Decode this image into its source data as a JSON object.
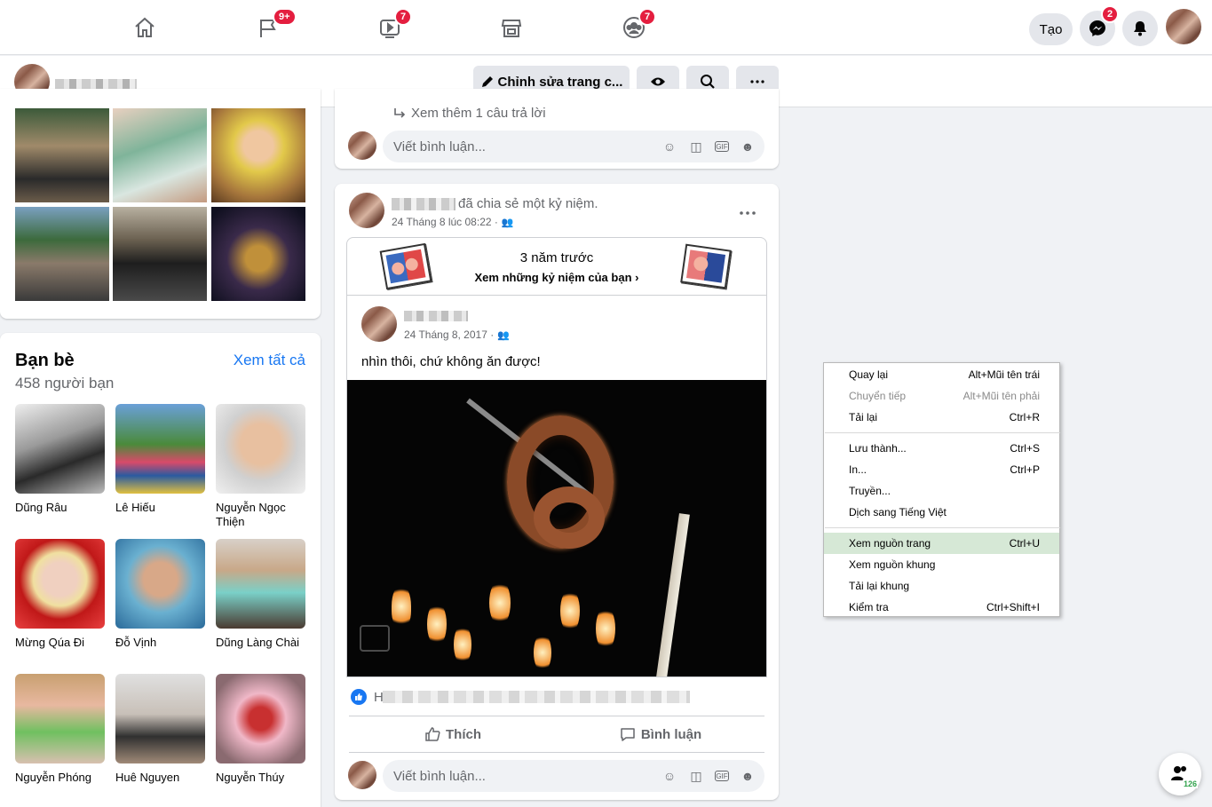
{
  "nav": {
    "badges": {
      "pages": "9+",
      "watch": "7",
      "groups": "7",
      "messenger": "2"
    },
    "create_label": "Tạo"
  },
  "profile_bar": {
    "edit_label": "Chỉnh sửa trang c..."
  },
  "friends": {
    "title": "Bạn bè",
    "see_all": "Xem tất cả",
    "count": "458 người bạn",
    "items": [
      {
        "name": "Dũng Râu"
      },
      {
        "name": "Lê Hiếu"
      },
      {
        "name": "Nguyễn Ngọc Thiện"
      },
      {
        "name": "Mừng Qúa Đi"
      },
      {
        "name": "Đỗ Vịnh"
      },
      {
        "name": "Dũng Làng Chài"
      },
      {
        "name": "Nguyễn Phóng"
      },
      {
        "name": "Huê Nguyen"
      },
      {
        "name": "Nguyễn Thúy"
      }
    ]
  },
  "feed": {
    "more_replies": "Xem thêm 1 câu trả lời",
    "comment_placeholder": "Viết bình luận...",
    "post": {
      "shared_text": "đã chia sẻ một kỷ niệm.",
      "date": "24 Tháng 8 lúc 08:22 ·",
      "memory_title": "3 năm trước",
      "memory_link": "Xem những kỷ niệm của bạn",
      "inner_date": "24 Tháng 8, 2017 ·",
      "caption": "nhìn thôi, chứ không ăn được!",
      "like_label": "Thích",
      "comment_label": "Bình luận",
      "reaction_prefix": "H"
    }
  },
  "context_menu": {
    "items": [
      {
        "label": "Quay lại",
        "shortcut": "Alt+Mũi tên trái",
        "disabled": false
      },
      {
        "label": "Chuyển tiếp",
        "shortcut": "Alt+Mũi tên phải",
        "disabled": true
      },
      {
        "label": "Tải lại",
        "shortcut": "Ctrl+R",
        "disabled": false
      },
      {
        "label": "Lưu thành...",
        "shortcut": "Ctrl+S",
        "disabled": false
      },
      {
        "label": "In...",
        "shortcut": "Ctrl+P",
        "disabled": false
      },
      {
        "label": "Truyền...",
        "shortcut": "",
        "disabled": false
      },
      {
        "label": "Dịch sang Tiếng Việt",
        "shortcut": "",
        "disabled": false
      },
      {
        "label": "Xem nguồn trang",
        "shortcut": "Ctrl+U",
        "disabled": false,
        "highlighted": true
      },
      {
        "label": "Xem nguồn khung",
        "shortcut": "",
        "disabled": false
      },
      {
        "label": "Tải lại khung",
        "shortcut": "",
        "disabled": false
      },
      {
        "label": "Kiểm tra",
        "shortcut": "Ctrl+Shift+I",
        "disabled": false
      }
    ]
  },
  "contacts_fab": {
    "count": "126"
  },
  "colors": {
    "accent": "#1877f2",
    "badge": "#e41e3f",
    "menu_highlight": "#d6e8d6"
  }
}
